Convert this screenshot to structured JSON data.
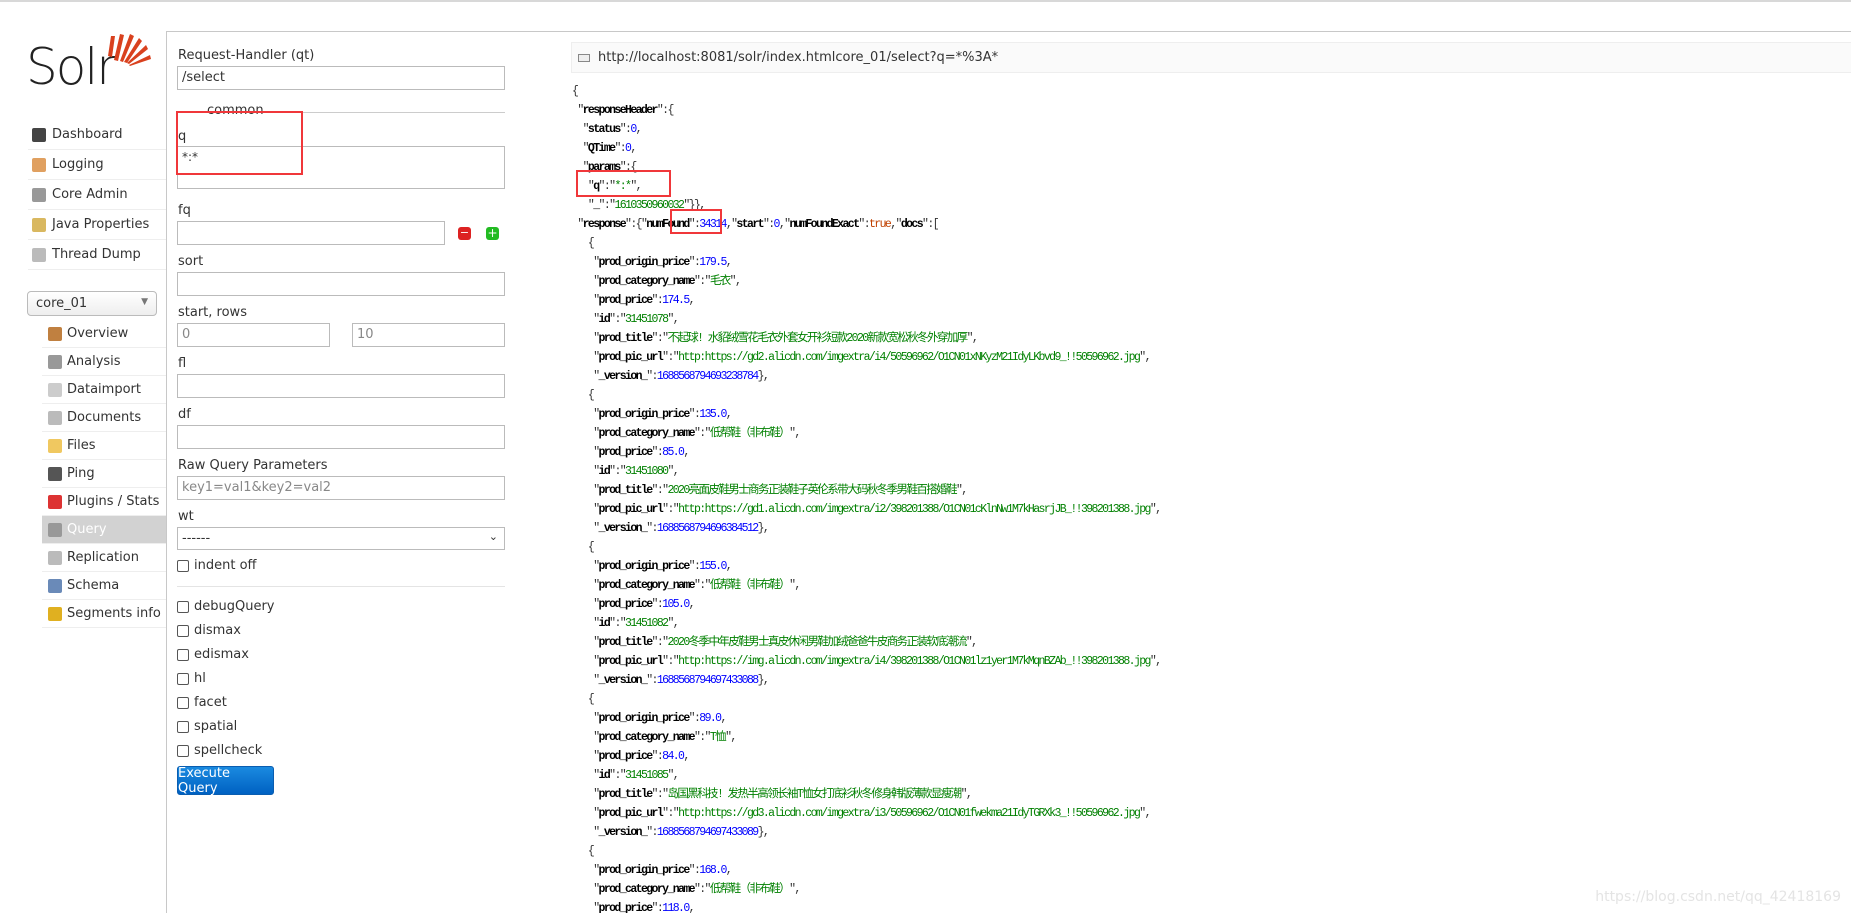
{
  "logo": {
    "text": "Solr"
  },
  "nav": [
    {
      "label": "Dashboard",
      "icon": "dashboard-icon",
      "color": "#444"
    },
    {
      "label": "Logging",
      "icon": "logging-icon",
      "color": "#e0a060"
    },
    {
      "label": "Core Admin",
      "icon": "core-admin-icon",
      "color": "#999"
    },
    {
      "label": "Java Properties",
      "icon": "java-properties-icon",
      "color": "#d9b860"
    },
    {
      "label": "Thread Dump",
      "icon": "thread-dump-icon",
      "color": "#bbb"
    }
  ],
  "core_selector": {
    "value": "core_01"
  },
  "core_nav": [
    {
      "label": "Overview",
      "icon": "home-icon",
      "color": "#c08040"
    },
    {
      "label": "Analysis",
      "icon": "funnel-icon",
      "color": "#999"
    },
    {
      "label": "Dataimport",
      "icon": "dataimport-icon",
      "color": "#ccc"
    },
    {
      "label": "Documents",
      "icon": "documents-icon",
      "color": "#bbb"
    },
    {
      "label": "Files",
      "icon": "folder-icon",
      "color": "#f0c860"
    },
    {
      "label": "Ping",
      "icon": "ping-icon",
      "color": "#555"
    },
    {
      "label": "Plugins / Stats",
      "icon": "plugins-icon",
      "color": "#d33"
    },
    {
      "label": "Query",
      "icon": "magnifier-icon",
      "color": "#999",
      "active": true
    },
    {
      "label": "Replication",
      "icon": "replication-icon",
      "color": "#bbb"
    },
    {
      "label": "Schema",
      "icon": "schema-icon",
      "color": "#6a8ab8"
    },
    {
      "label": "Segments info",
      "icon": "segments-icon",
      "color": "#e0b020"
    }
  ],
  "form": {
    "request_handler_label": "Request-Handler (qt)",
    "request_handler_value": "/select",
    "legend": "common",
    "q_label": "q",
    "q_value": "*:*",
    "fq_label": "fq",
    "fq_value": "",
    "sort_label": "sort",
    "sort_value": "",
    "start_rows_label": "start, rows",
    "start_value": "0",
    "rows_value": "10",
    "fl_label": "fl",
    "fl_value": "",
    "df_label": "df",
    "df_value": "",
    "raw_label": "Raw Query Parameters",
    "raw_placeholder": "key1=val1&key2=val2",
    "wt_label": "wt",
    "wt_value": "------",
    "indent_label": "indent off",
    "checkboxes": [
      "debugQuery",
      "dismax",
      "edismax",
      "hl",
      "facet",
      "spatial",
      "spellcheck"
    ],
    "execute_label": "Execute Query"
  },
  "result": {
    "url": "http://localhost:8081/solr/index.htmlcore_01/select?q=*%3A*",
    "responseHeader": {
      "status": "0",
      "QTime": "0",
      "params": {
        "q": "*:*",
        "_": "1610350960032"
      }
    },
    "response": {
      "numFound": "34314",
      "start": "0",
      "numFoundExact": "true"
    },
    "docs": [
      {
        "prod_origin_price": "179.5",
        "prod_category_name": "毛衣",
        "prod_price": "174.5",
        "id": "31451078",
        "prod_title": "不起球! 水貂绒雪花毛衣外套女开衫短款2020新款宽松秋冬外穿加厚",
        "prod_pic_url": "http:https://gd2.alicdn.com/imgextra/i4/50596962/O1CN01xNKyzM21IdyLKbvd9_!!50596962.jpg",
        "_version_": "1688568794693238784"
      },
      {
        "prod_origin_price": "135.0",
        "prod_category_name": "低帮鞋（非布鞋）",
        "prod_price": "85.0",
        "id": "31451080",
        "prod_title": "2020亮面皮鞋男士商务正装鞋子英伦系带大码秋冬季男鞋百搭婚鞋",
        "prod_pic_url": "http:https://gd1.alicdn.com/imgextra/i2/398201388/O1CN01cKlnNw1M7kHasrjJB_!!398201388.jpg",
        "_version_": "1688568794696384512"
      },
      {
        "prod_origin_price": "155.0",
        "prod_category_name": "低帮鞋（非布鞋）",
        "prod_price": "105.0",
        "id": "31451082",
        "prod_title": "2020冬季中年皮鞋男士真皮休闲男鞋加绒爸爸牛皮商务正装软底潮流",
        "prod_pic_url": "http:https://img.alicdn.com/imgextra/i4/398201388/O1CN01lz1yer1M7kMqnBZAb_!!398201388.jpg",
        "_version_": "1688568794697433088"
      },
      {
        "prod_origin_price": "89.0",
        "prod_category_name": "T恤",
        "prod_price": "84.0",
        "id": "31451085",
        "prod_title": "岛国黑科技! 发热半高领长袖T恤女打底衫秋冬修身韩版薄款显瘦潮",
        "prod_pic_url": "http:https://gd3.alicdn.com/imgextra/i3/50596962/O1CN01fwekma21IdyTGRXk3_!!50596962.jpg",
        "_version_": "1688568794697433089"
      },
      {
        "prod_origin_price": "168.0",
        "prod_category_name": "低帮鞋（非布鞋）",
        "prod_price": "118.0"
      }
    ]
  },
  "watermark": "https://blog.csdn.net/qq_42418169",
  "colors": {
    "string": "#008000",
    "number": "#0000ff",
    "boolean": "#c04000",
    "highlight_box": "#f0373a",
    "button": "#0a74d6"
  }
}
